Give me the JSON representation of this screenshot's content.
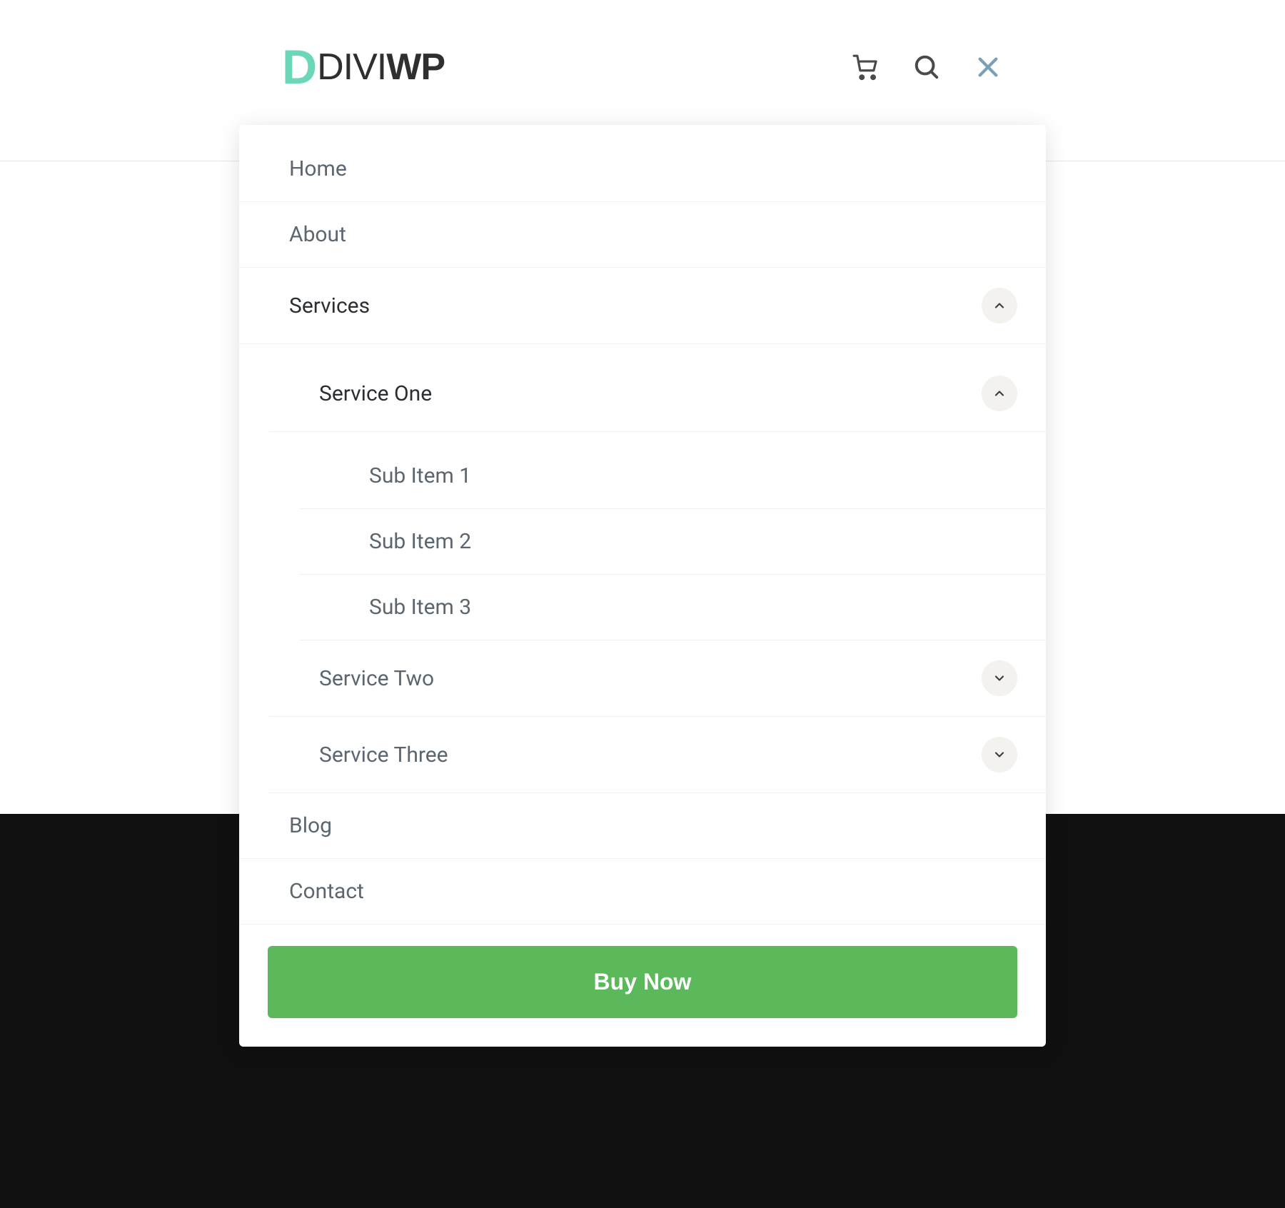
{
  "logo": {
    "mark": "D",
    "text_normal": "DIVI",
    "text_bold": "WP"
  },
  "menu": {
    "home": "Home",
    "about": "About",
    "services": {
      "label": "Services",
      "service_one": {
        "label": "Service One",
        "sub1": "Sub Item 1",
        "sub2": "Sub Item 2",
        "sub3": "Sub Item 3"
      },
      "service_two": "Service Two",
      "service_three": "Service Three"
    },
    "blog": "Blog",
    "contact": "Contact"
  },
  "cta": {
    "buy_now": "Buy Now"
  }
}
